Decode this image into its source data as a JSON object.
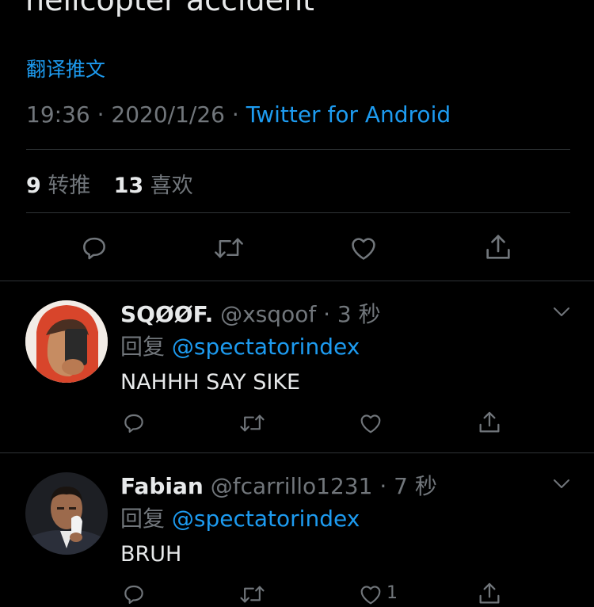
{
  "main_tweet": {
    "text_tail": "helicopter accident",
    "translate_link": "翻译推文",
    "time": "19:36",
    "date": "2020/1/26",
    "source": "Twitter for Android",
    "retweets_count": "9",
    "retweets_label": "转推",
    "likes_count": "13",
    "likes_label": "喜欢"
  },
  "replies": [
    {
      "display_name": "SQØØF.",
      "handle": "@xsqoof",
      "time": "3 秒",
      "reply_prefix": "回复",
      "mention": "@spectatorindex",
      "text": "NAHHH SAY SIKE"
    },
    {
      "display_name": "Fabian",
      "handle": "@fcarrillo1231",
      "time": "7 秒",
      "reply_prefix": "回复",
      "mention": "@spectatorindex",
      "text": "BRUH",
      "like_count": "1"
    }
  ],
  "colors": {
    "background": "#000000",
    "accent": "#1d9bf0",
    "secondary_text": "#71767b",
    "divider": "#2f3336"
  },
  "icons": {
    "reply": "speech-bubble-icon",
    "retweet": "retweet-arrows-icon",
    "like": "heart-icon",
    "share": "share-upload-icon",
    "more": "chevron-down-icon"
  }
}
